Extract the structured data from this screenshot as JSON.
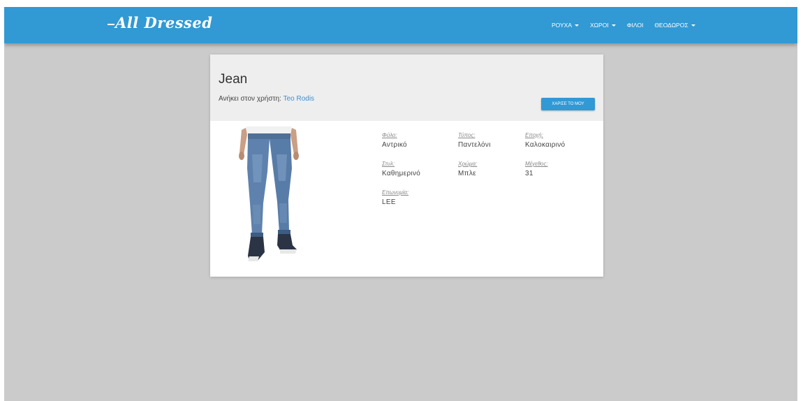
{
  "brand": {
    "logo_text": "All Dressed"
  },
  "nav": {
    "items": [
      {
        "label": "ΡΟΥΧΑ",
        "has_dropdown": true
      },
      {
        "label": "ΧΩΡΟΙ",
        "has_dropdown": true
      },
      {
        "label": "ΦΙΛΟΙ",
        "has_dropdown": false
      },
      {
        "label": "ΘΕΟΔΩΡΟΣ",
        "has_dropdown": true
      }
    ]
  },
  "item": {
    "title": "Jean",
    "owner_prefix": "Ανήκει στον χρήστη:",
    "owner_name": "Teo Rodis",
    "gift_button_label": "ΧΑΡΙΣΕ ΤΟ ΜΟΥ",
    "image_alt": "jeans-photo",
    "attributes": [
      {
        "label": "Φύλο:",
        "value": "Αντρικό"
      },
      {
        "label": "Τύπος:",
        "value": "Παντελόνι"
      },
      {
        "label": "Εποχή:",
        "value": "Καλοκαιρινό"
      },
      {
        "label": "Στυλ:",
        "value": "Καθημερινό"
      },
      {
        "label": "Χρώμα:",
        "value": "Μπλε"
      },
      {
        "label": "Μέγεθος:",
        "value": "31"
      },
      {
        "label": "Επωνυμία:",
        "value": "LEE"
      }
    ]
  },
  "colors": {
    "navbar": "#3199d4",
    "page_background": "#cbcbcb",
    "card_header": "#eeeeee",
    "link": "#3c8fd0"
  },
  "icons": {
    "dropdown": "caret-down-icon"
  }
}
